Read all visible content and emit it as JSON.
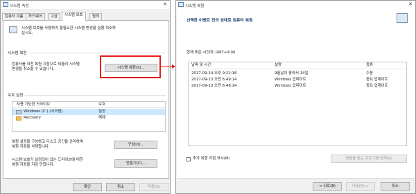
{
  "left_dialog": {
    "title": "시스템 속성",
    "tabs": [
      "컴퓨터 이름",
      "하드웨어",
      "고급",
      "시스템 보호",
      "원격"
    ],
    "intro": [
      "시스템 보호를 사용하여 불필요한 시스템 변경을 실행 취소하",
      "십시오."
    ],
    "restore_section": {
      "label": "시스템 복원",
      "text": [
        "컴퓨터를 이전 복원 지점으로 되돌려 시스템",
        "변경을 취소할 수 있습니다."
      ],
      "button": "시스템 복원(S)..."
    },
    "protection_section": {
      "label": "보호 설정",
      "columns": [
        "사용 가능한 드라이브",
        "보호"
      ],
      "drives": [
        {
          "name": "Windows (C:) (시스템)",
          "protection": "설정"
        },
        {
          "name": "Recovery",
          "protection": "해제"
        }
      ]
    },
    "configure": {
      "text": [
        "복원 설정을 구성하고 디스크 공간을 관리하며",
        "복원 지점을 삭제합니다."
      ],
      "button": "구성(O)..."
    },
    "create": {
      "text": [
        "시스템 보호가 설정되어 있는 드라이브에 대한",
        "복원 지점을 지금 만듭니다."
      ],
      "button": "만들기(C)..."
    },
    "footer_buttons": {
      "ok": "확인",
      "cancel": "취소",
      "apply": "적용(A)"
    }
  },
  "right_dialog": {
    "title": "시스템 복원",
    "heading": "선택한 이벤트 전의 상태로 컴퓨터 복원",
    "timezone": "현재 표준 시간대: GMT+9:00",
    "columns": [
      "날짜 및 시간",
      "설명",
      "종류"
    ],
    "rows": [
      {
        "datetime": "2017-09-14 오후 9:22:16",
        "description": "9월날이 좋아서 14일",
        "type": "수동"
      },
      {
        "datetime": "2017-09-13 오전 6:49:14",
        "description": "Windows 업데이트",
        "type": "중요 업데이트"
      },
      {
        "datetime": "2017-09-13 오전 6:48:14",
        "description": "Windows 업데이트",
        "type": "중요 업데이트"
      }
    ],
    "show_more": "추가 복원 지점 표시(M)",
    "scan_button": "영향을 받는 프로그램 검색(A)",
    "footer_buttons": {
      "back": "< 뒤로(B)",
      "next": "다음(N) >",
      "cancel": "취소"
    }
  },
  "colors": {
    "highlight": "#e51b1b",
    "selected_row": "#cce8ff"
  }
}
